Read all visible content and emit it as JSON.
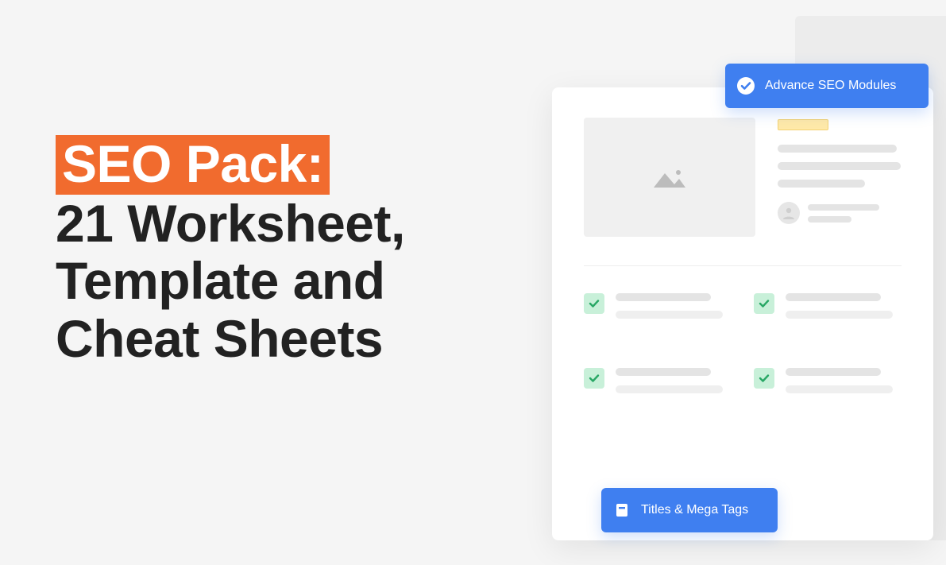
{
  "hero": {
    "highlight": "SEO Pack:",
    "line1": "21 Worksheet,",
    "line2": "Template and",
    "line3": "Cheat Sheets"
  },
  "badges": {
    "top": {
      "label": "Advance SEO Modules",
      "icon": "check-circle-icon"
    },
    "bottom": {
      "label": "Titles & Mega Tags",
      "icon": "document-icon"
    }
  },
  "card": {
    "thumbnail_icon": "image-placeholder-icon",
    "avatar_icon": "user-circle-icon",
    "checklist_count": 4,
    "check_icon": "checkmark-icon"
  }
}
